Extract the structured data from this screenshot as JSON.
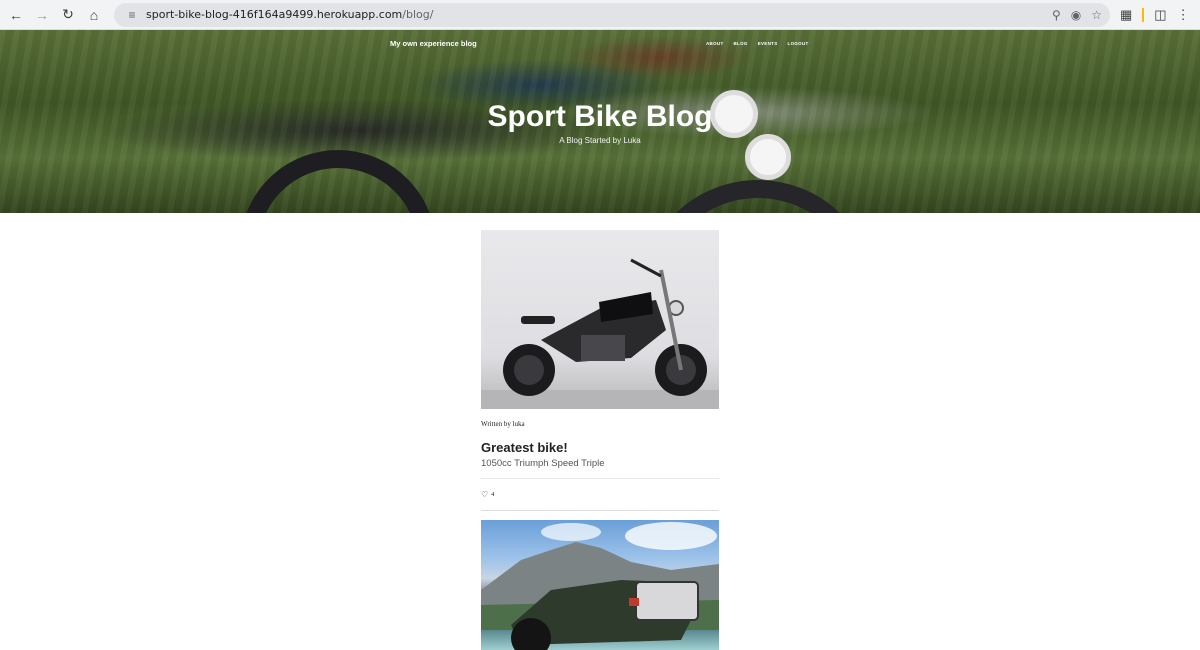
{
  "browser": {
    "url_host": "sport-bike-blog-416f164a9499.herokuapp.com",
    "url_path": "/blog/",
    "icons": {
      "back": "back-arrow-icon",
      "forward": "forward-arrow-icon",
      "reload": "reload-icon",
      "home": "home-icon",
      "site_info": "tune-icon",
      "zoom": "magnifier-icon",
      "tracking": "eye-off-icon",
      "bookmark": "star-icon",
      "extensions": "puzzle-icon",
      "sidepanel": "side-panel-icon",
      "menu": "kebab-menu-icon"
    }
  },
  "site": {
    "brand": "My own experience blog",
    "nav": [
      "ABOUT",
      "BLOG",
      "EVENTS",
      "LOGOUT"
    ],
    "hero_title": "Sport Bike Blog",
    "hero_subtitle": "A Blog Started by Luka"
  },
  "posts": [
    {
      "author": "Written by luka",
      "title": "Greatest bike!",
      "subtitle": "1050cc Triumph Speed Triple",
      "likes": "4",
      "image": "motorcycle-studio-photo"
    },
    {
      "image": "motorcycle-mountain-photo"
    }
  ],
  "colors": {
    "text": "#222222",
    "muted": "#555555",
    "hero_text": "#ffffff",
    "omnibox": "#e1e3e6"
  }
}
